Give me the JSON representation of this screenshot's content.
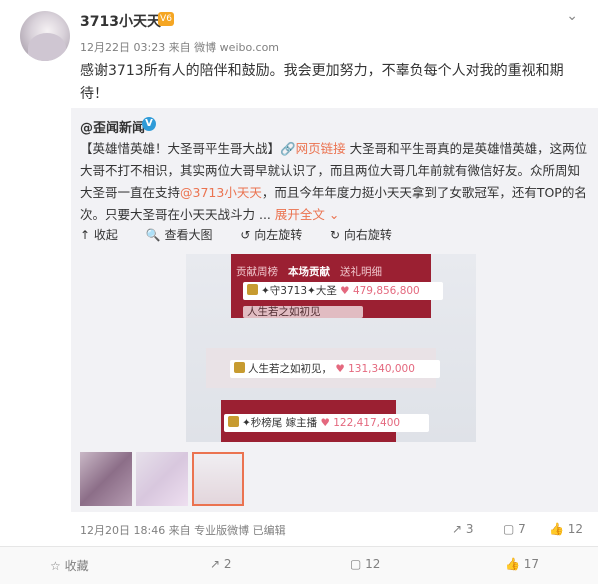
{
  "post": {
    "username": "3713小天天",
    "vip_badge": "V6",
    "meta": "12月22日 03:23 来自 微博 weibo.com",
    "text": "感谢3713所有人的陪伴和鼓励。我会更加努力，不辜负每个人对我的重视和期待！"
  },
  "repost": {
    "author": "@歪闻新闻",
    "verified_mark": "V",
    "text_part1": "【英雄惜英雄！大圣哥平生哥大战】",
    "link1": "网页链接",
    "text_part2": " 大圣哥和平生哥真的是英雄惜英雄，这两位大哥不打不相识，其实两位大哥早就认识了，而且两位大哥几年前就有微信好友。众所周知大圣哥一直在支持",
    "mention": "@3713小天天",
    "text_part3": "，而且今年年度力挺小天天拿到了女歌冠军，还有TOP的名次。只要大圣哥在小天天战斗力 ... ",
    "expand": "展开全文",
    "actions": {
      "collapse": "收起",
      "view_large": "查看大图",
      "rotate_left": "向左旋转",
      "rotate_right": "向右旋转"
    },
    "image": {
      "tabs": [
        "贡献周榜",
        "本场贡献",
        "送礼明细"
      ],
      "rows": [
        {
          "name": "✦守3713✦大圣",
          "value": "479,856,800"
        },
        {
          "name": "人生若之如初见",
          "value": ""
        },
        {
          "name": "人生若之如初见，",
          "value": "131,340,000"
        },
        {
          "name": "✦秒榜尾 嫁主播",
          "value": "122,417,400"
        }
      ]
    },
    "footer": "12月20日 18:46 来自 专业版微博 已编辑",
    "counts": {
      "repost": "3",
      "comment": "7",
      "like": "12"
    }
  },
  "bottom_bar": {
    "favorite": "收藏",
    "repost": "2",
    "comment": "12",
    "like": "17"
  },
  "colors": {
    "link": "#eb7350",
    "accent": "#9b2032"
  }
}
